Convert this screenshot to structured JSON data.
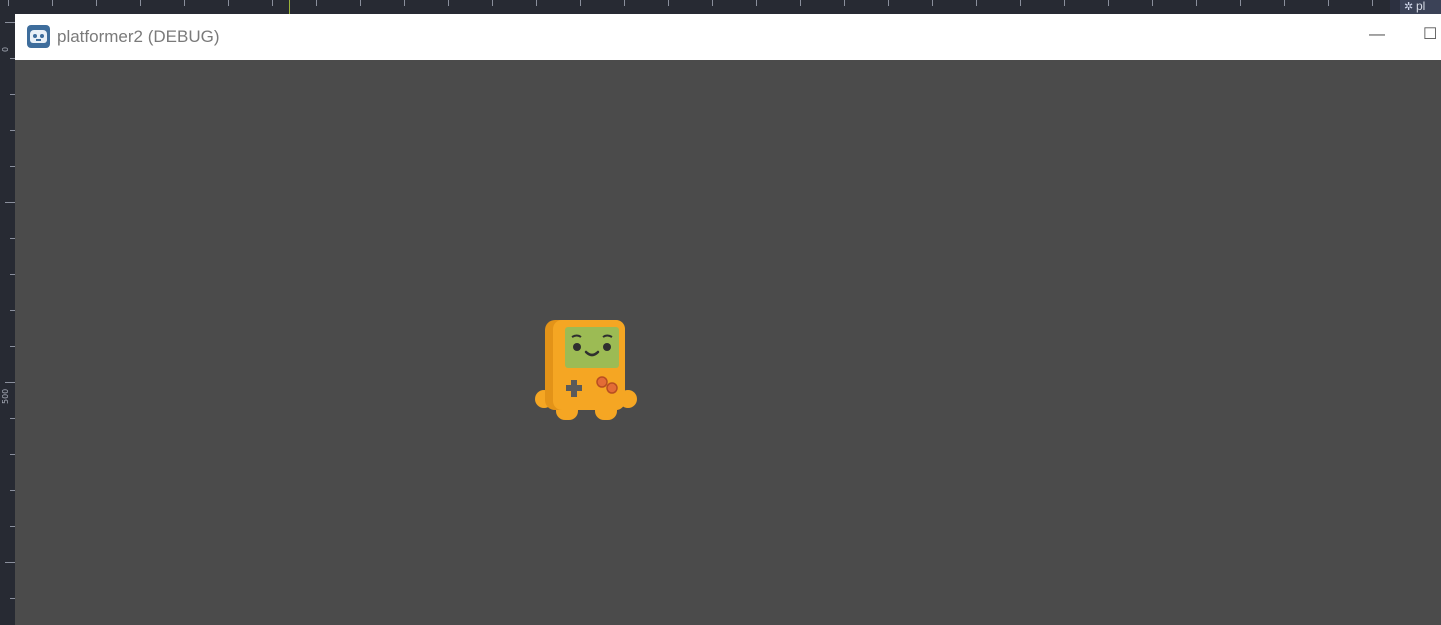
{
  "editor": {
    "right_tab_label": "pl",
    "ruler_labels": [
      "0",
      "500"
    ]
  },
  "window": {
    "title": "platformer2 (DEBUG)",
    "minimize_glyph": "—",
    "maximize_glyph": "☐"
  },
  "viewport": {
    "background_color": "#4b4b4b",
    "player_icon": "handheld-console-character-icon"
  },
  "colors": {
    "player_body": "#f5a623",
    "player_screen": "#9cbb54",
    "player_buttons": "#e36c36"
  }
}
